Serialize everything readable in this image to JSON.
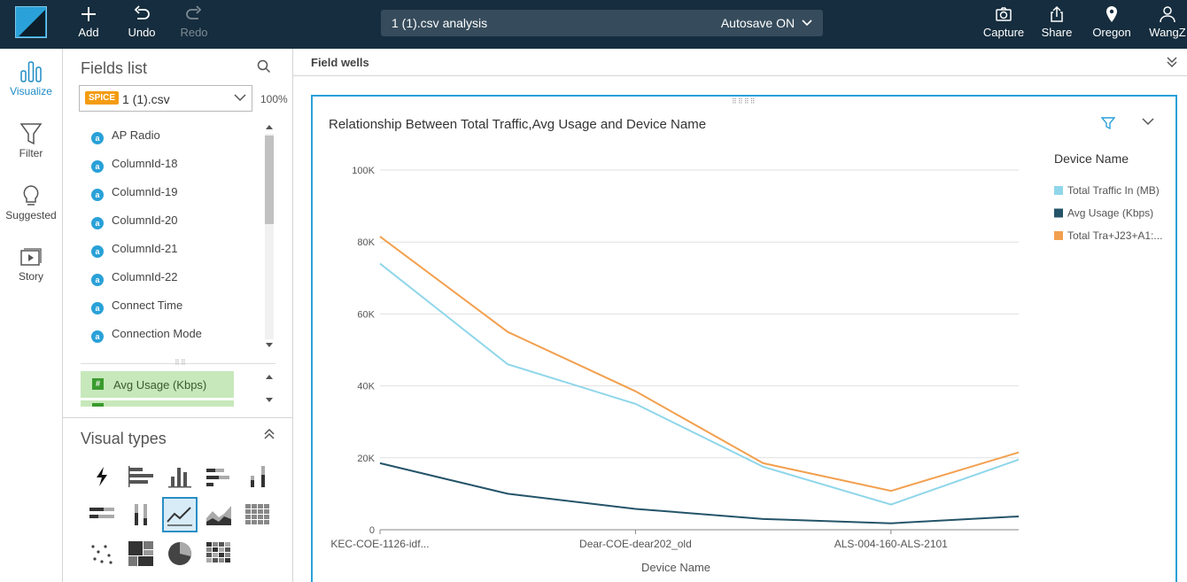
{
  "topbar": {
    "add_label": "Add",
    "undo_label": "Undo",
    "redo_label": "Redo",
    "analysis_title": "1 (1).csv analysis",
    "autosave_label": "Autosave ON",
    "capture_label": "Capture",
    "share_label": "Share",
    "region_label": "Oregon",
    "user_label": "WangZ"
  },
  "leftnav": {
    "items": [
      {
        "label": "Visualize",
        "icon": "bar-chart-icon",
        "active": true
      },
      {
        "label": "Filter",
        "icon": "funnel-icon",
        "active": false
      },
      {
        "label": "Suggested",
        "icon": "lightbulb-icon",
        "active": false
      },
      {
        "label": "Story",
        "icon": "play-slides-icon",
        "active": false
      }
    ]
  },
  "fields_panel": {
    "title": "Fields list",
    "dataset_badge": "SPICE",
    "dataset_name": "1 (1).csv",
    "spice_percent": "100%",
    "dimension_badge": "a",
    "measure_badge": "#",
    "fields": [
      "AP Radio",
      "ColumnId-18",
      "ColumnId-19",
      "ColumnId-20",
      "ColumnId-21",
      "ColumnId-22",
      "Connect Time",
      "Connection Mode"
    ],
    "measures": [
      "Avg Usage (Kbps)"
    ]
  },
  "visual_types": {
    "title": "Visual types",
    "selected": "line-chart"
  },
  "field_wells": {
    "label": "Field wells"
  },
  "colors": {
    "accent": "#2aa1d8",
    "topbar": "#152d3e",
    "series_light_blue": "#8fd6ea",
    "series_dark_teal": "#245469",
    "series_orange": "#f2a04f"
  },
  "chart_data": {
    "type": "line",
    "title": "Relationship Between Total Traffic,Avg Usage and Device Name",
    "xlabel": "Device Name",
    "ylabel": "",
    "ylim": [
      0,
      100000
    ],
    "yticks": [
      0,
      20000,
      40000,
      60000,
      80000,
      100000
    ],
    "ytick_labels": [
      "0",
      "20K",
      "40K",
      "60K",
      "80K",
      "100K"
    ],
    "x_tick_labels": [
      "KEC-COE-1126-idf...",
      "Dear-COE-dear202_old",
      "ALS-004-160-ALS-2101"
    ],
    "grid": true,
    "legend_title": "Device Name",
    "legend_position": "right",
    "series": [
      {
        "name": "Total Traffic In (MB)",
        "color": "#8fd6ea",
        "values": [
          74000,
          46000,
          35000,
          17500,
          7000,
          19500
        ]
      },
      {
        "name": "Avg Usage (Kbps)",
        "color": "#245469",
        "values": [
          18500,
          10000,
          5800,
          3000,
          1800,
          3700
        ]
      },
      {
        "name": "Total Tra+J23+A1:...",
        "color": "#f2a04f",
        "values": [
          81500,
          55000,
          38500,
          18500,
          10800,
          21500
        ]
      }
    ]
  }
}
